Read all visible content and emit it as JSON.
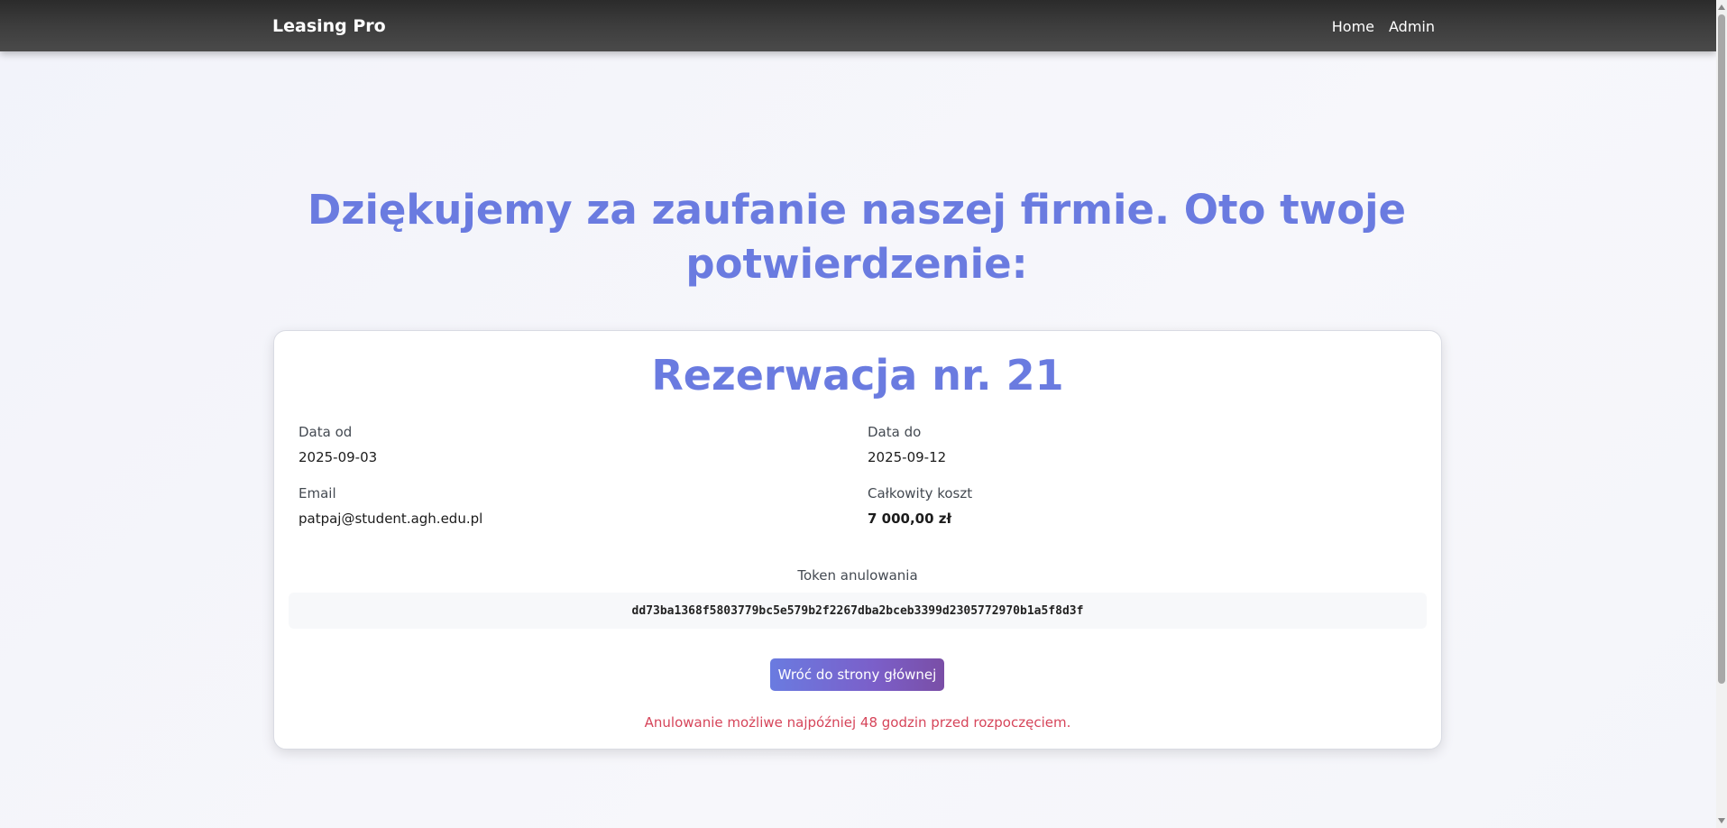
{
  "header": {
    "brand": "Leasing Pro",
    "nav": [
      "Home",
      "Admin"
    ]
  },
  "main": {
    "headline": "Dziękujemy za zaufanie naszej firmie. Oto twoje potwierdzenie:"
  },
  "reservation": {
    "title": "Rezerwacja nr. 21",
    "date_from_label": "Data od",
    "date_from": "2025-09-03",
    "date_to_label": "Data do",
    "date_to": "2025-09-12",
    "email_label": "Email",
    "email": "patpaj@student.agh.edu.pl",
    "total_cost_label": "Całkowity koszt",
    "total_cost": "7 000,00 zł",
    "token_label": "Token anulowania",
    "token": "dd73ba1368f5803779bc5e579b2f2267dba2bceb3399d2305772970b1a5f8d3f",
    "back_button_label": "Wróć do strony głównej",
    "cancel_notice": "Anulowanie możliwe najpóźniej 48 godzin przed rozpoczęciem."
  },
  "colors": {
    "accent": "#6a7be0",
    "warning": "#d6455a",
    "navbar": "#3d3d3d"
  }
}
